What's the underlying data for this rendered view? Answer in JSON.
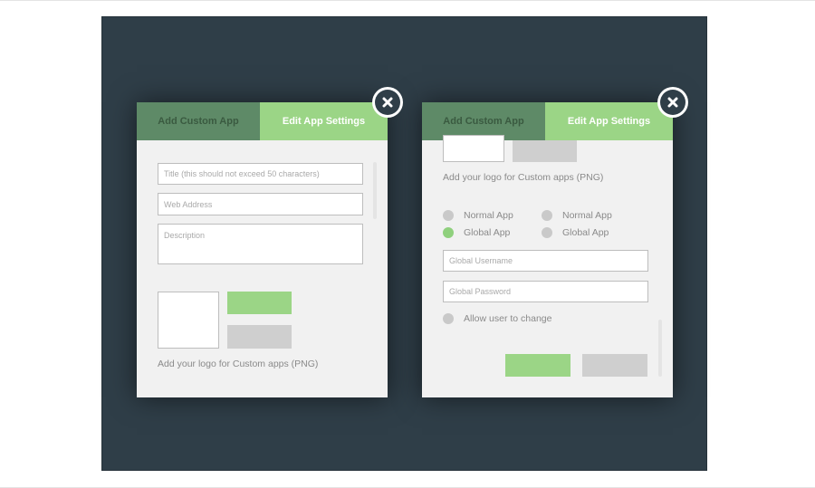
{
  "left_panel": {
    "tab_add": "Add Custom App",
    "tab_edit": "Edit App Settings",
    "title_placeholder": "Title (this should not exceed 50 characters)",
    "web_address_placeholder": "Web Address",
    "description_placeholder": "Description",
    "logo_caption": "Add your logo for Custom apps (PNG)"
  },
  "right_panel": {
    "tab_add": "Add Custom App",
    "tab_edit": "Edit App Settings",
    "logo_caption": "Add your logo for Custom apps (PNG)",
    "radio_col1": [
      {
        "label": "Normal App",
        "selected": false
      },
      {
        "label": "Global App",
        "selected": true
      }
    ],
    "radio_col2": [
      {
        "label": "Normal App",
        "selected": false
      },
      {
        "label": "Global App",
        "selected": false
      }
    ],
    "global_username_placeholder": "Global Username",
    "global_password_placeholder": "Global Password",
    "allow_change_label": "Allow user to change"
  },
  "icons": {
    "close": "close-icon"
  },
  "colors": {
    "backdrop": "#2f3e48",
    "tab_inactive": "#5e8a67",
    "tab_active": "#9bd586",
    "button_green": "#9bd586",
    "button_gray": "#cfcfcf",
    "panel_bg": "#f1f1f1"
  }
}
